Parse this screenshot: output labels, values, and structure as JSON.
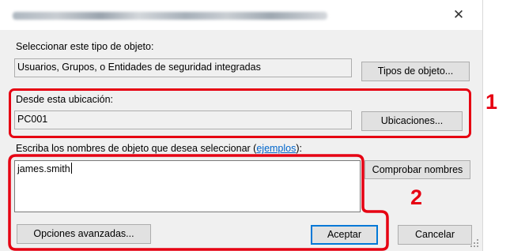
{
  "dialog": {
    "close_glyph": "✕",
    "object_type": {
      "label": "Seleccionar este tipo de objeto:",
      "value": "Usuarios, Grupos, o Entidades de seguridad integradas",
      "button": "Tipos de objeto..."
    },
    "location": {
      "label": "Desde esta ubicación:",
      "value": "PC001",
      "button": "Ubicaciones..."
    },
    "names": {
      "label_prefix": "Escriba los nombres de objeto que desea seleccionar (",
      "link": "ejemplos",
      "label_suffix": "):",
      "value": "james.smith",
      "check_button": "Comprobar nombres"
    },
    "advanced_button": "Opciones avanzadas...",
    "ok_button": "Aceptar",
    "cancel_button": "Cancelar"
  },
  "callouts": {
    "one": "1",
    "two": "2"
  },
  "colors": {
    "highlight": "#e60012",
    "default_button_border": "#0078d7",
    "link": "#0066cc"
  }
}
